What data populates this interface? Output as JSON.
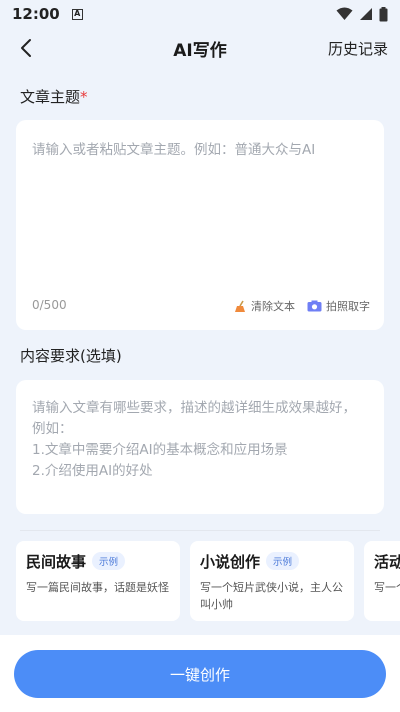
{
  "status_bar": {
    "time": "12:00",
    "badge": "A"
  },
  "header": {
    "title": "AI写作",
    "history_label": "历史记录"
  },
  "topic": {
    "label": "文章主题",
    "required_mark": "*",
    "placeholder": "请输入或者粘贴文章主题。例如：普通大众与AI",
    "counter": "0/500",
    "clear_label": "清除文本",
    "photo_label": "拍照取字"
  },
  "requirements": {
    "label": "内容要求(选填)",
    "placeholder_lines": [
      "请输入文章有哪些要求，描述的越详细生成效果越好，",
      "例如：",
      "1.文章中需要介绍AI的基本概念和应用场景",
      "2.介绍使用AI的好处"
    ]
  },
  "examples": [
    {
      "title": "民间故事",
      "tag": "示例",
      "desc": "写一篇民间故事，话题是妖怪"
    },
    {
      "title": "小说创作",
      "tag": "示例",
      "desc": "写一个短片武侠小说，主人公叫小帅"
    },
    {
      "title": "活动",
      "tag": "",
      "desc": "写一个"
    }
  ],
  "cta_label": "一键创作",
  "colors": {
    "accent": "#4c8df7",
    "background": "#eef3fb",
    "required": "#e83b3b"
  },
  "icons": [
    "back-arrow-icon",
    "wifi-icon",
    "cellular-signal-icon",
    "battery-icon",
    "broom-icon",
    "camera-icon"
  ]
}
